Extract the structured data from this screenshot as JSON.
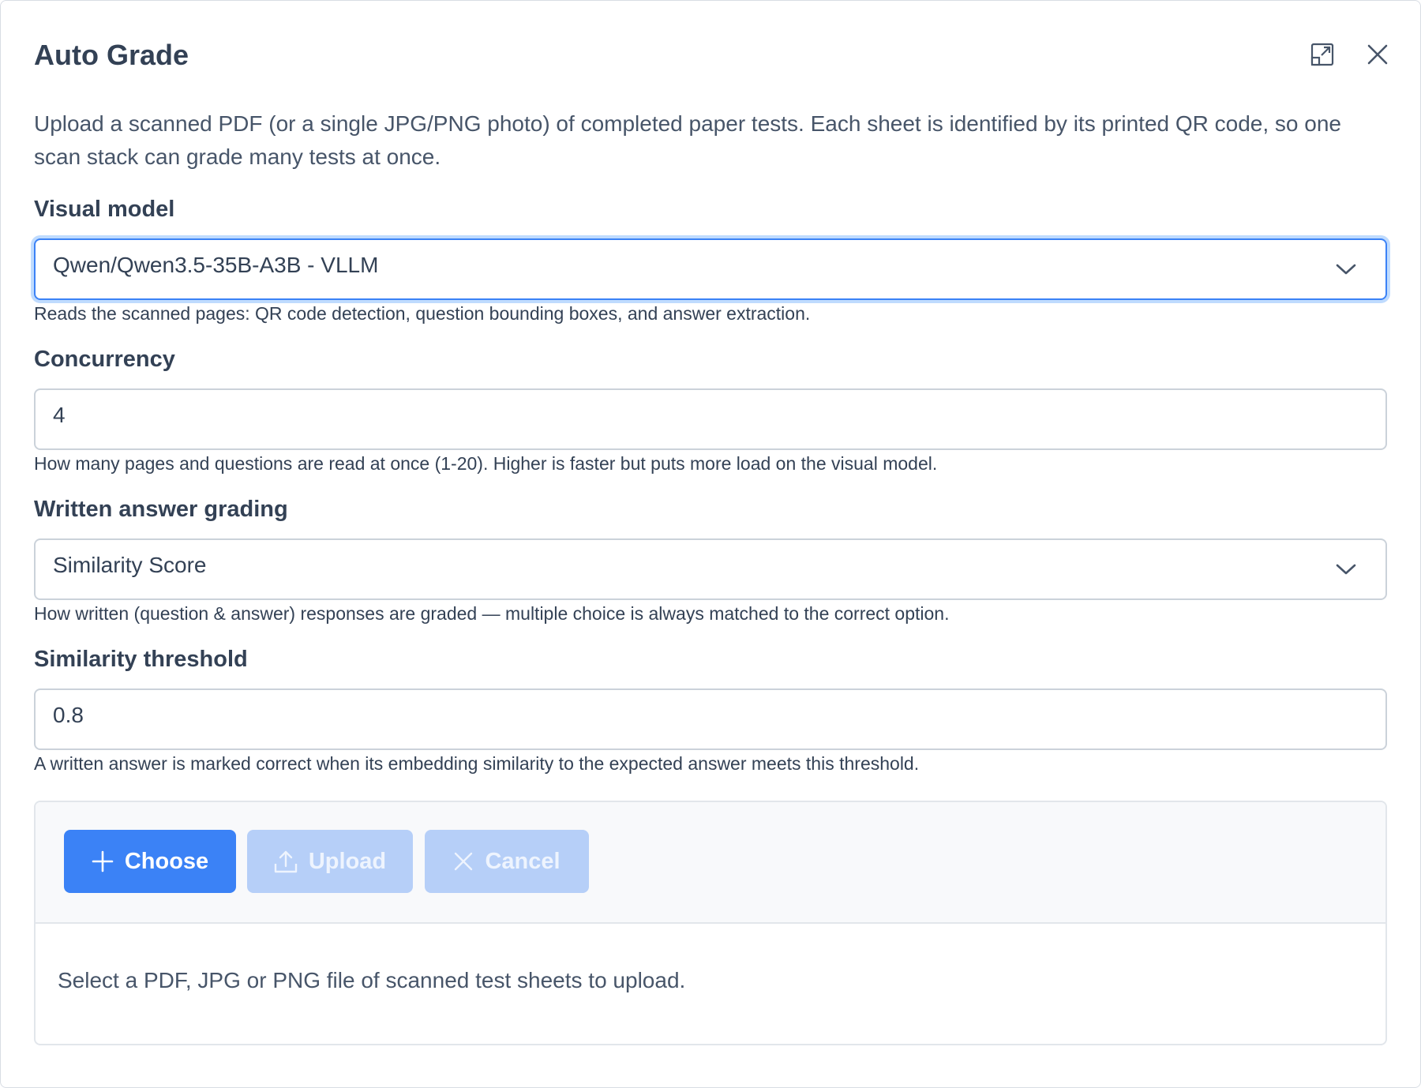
{
  "dialog": {
    "title": "Auto Grade",
    "description": "Upload a scanned PDF (or a single JPG/PNG photo) of completed paper tests. Each sheet is identified by its printed QR code, so one scan stack can grade many tests at once.",
    "icons": {
      "maximize": "maximize-icon",
      "close": "close-icon"
    }
  },
  "fields": {
    "visual_model": {
      "label": "Visual model",
      "value": "Qwen/Qwen3.5-35B-A3B - VLLM",
      "help": "Reads the scanned pages: QR code detection, question bounding boxes, and answer extraction."
    },
    "concurrency": {
      "label": "Concurrency",
      "value": "4",
      "help": "How many pages and questions are read at once (1-20). Higher is faster but puts more load on the visual model."
    },
    "written_grading": {
      "label": "Written answer grading",
      "value": "Similarity Score",
      "help": "How written (question & answer) responses are graded — multiple choice is always matched to the correct option."
    },
    "similarity_threshold": {
      "label": "Similarity threshold",
      "value": "0.8",
      "help": "A written answer is marked correct when its embedding similarity to the expected answer meets this threshold."
    }
  },
  "upload": {
    "choose_label": "Choose",
    "upload_label": "Upload",
    "cancel_label": "Cancel",
    "empty_message": "Select a PDF, JPG or PNG file of scanned test sheets to upload."
  },
  "colors": {
    "primary": "#3b82f6",
    "primary_disabled": "#b6cff8",
    "focus_ring": "#bfdbfe",
    "text": "#334155"
  }
}
